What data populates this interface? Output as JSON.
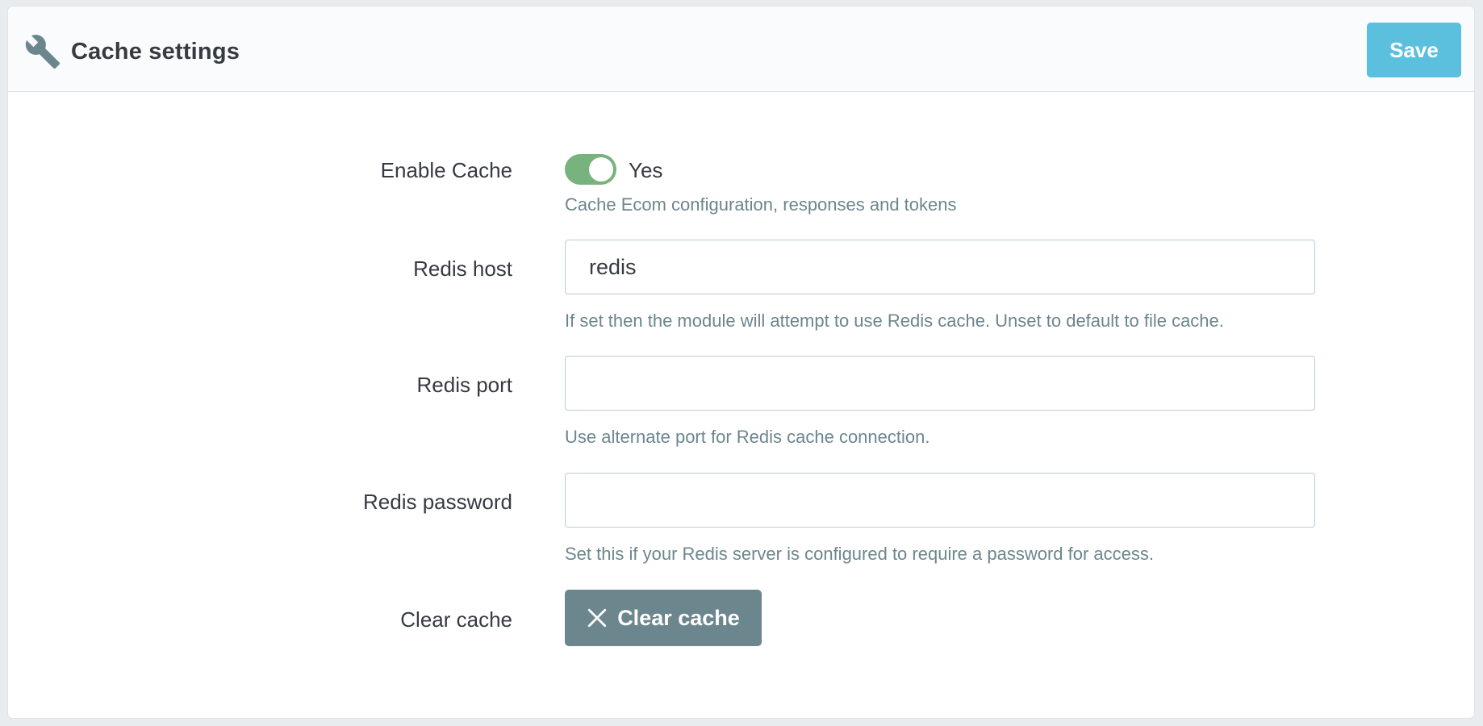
{
  "header": {
    "title": "Cache settings",
    "icon": "wrench-icon",
    "save_label": "Save"
  },
  "form": {
    "enable_cache": {
      "label": "Enable Cache",
      "state": true,
      "state_label": "Yes",
      "help": "Cache Ecom configuration, responses and tokens"
    },
    "redis_host": {
      "label": "Redis host",
      "value": "redis",
      "help": "If set then the module will attempt to use Redis cache. Unset to default to file cache."
    },
    "redis_port": {
      "label": "Redis port",
      "value": "",
      "help": "Use alternate port for Redis cache connection."
    },
    "redis_password": {
      "label": "Redis password",
      "value": "",
      "help": "Set this if your Redis server is configured to require a password for access."
    },
    "clear_cache": {
      "label": "Clear cache",
      "button_label": "Clear cache",
      "button_icon": "close-icon"
    }
  },
  "colors": {
    "save_button": "#5bc0de",
    "toggle_on": "#78b37e",
    "clear_button": "#6c868e",
    "help_text": "#6c868e"
  }
}
